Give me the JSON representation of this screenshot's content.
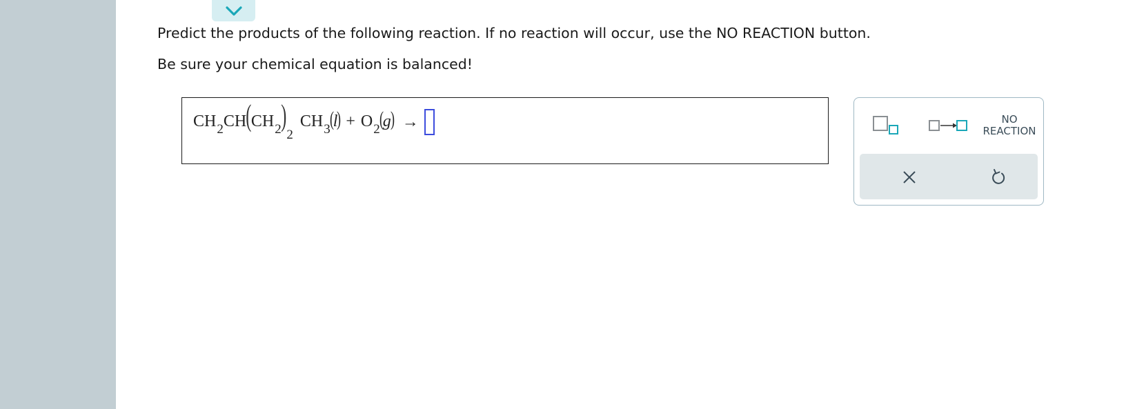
{
  "prompt": {
    "line1": "Predict the products of the following reaction. If no reaction will occur, use the NO REACTION button.",
    "line2": "Be sure your chemical equation is balanced!"
  },
  "equation": {
    "ch": "CH",
    "c_h": "CH",
    "two": "2",
    "three": "3",
    "o": "O",
    "plus": "+",
    "state_liquid": "l",
    "state_gas": "g",
    "open_paren": "(",
    "close_paren": ")",
    "arrow": "→"
  },
  "palette": {
    "no_reaction_line1": "NO",
    "no_reaction_line2": "REACTION"
  },
  "colors": {
    "accent": "#1aa7b8",
    "rail": "#c2ced3",
    "cursor": "#3c4cdd"
  }
}
